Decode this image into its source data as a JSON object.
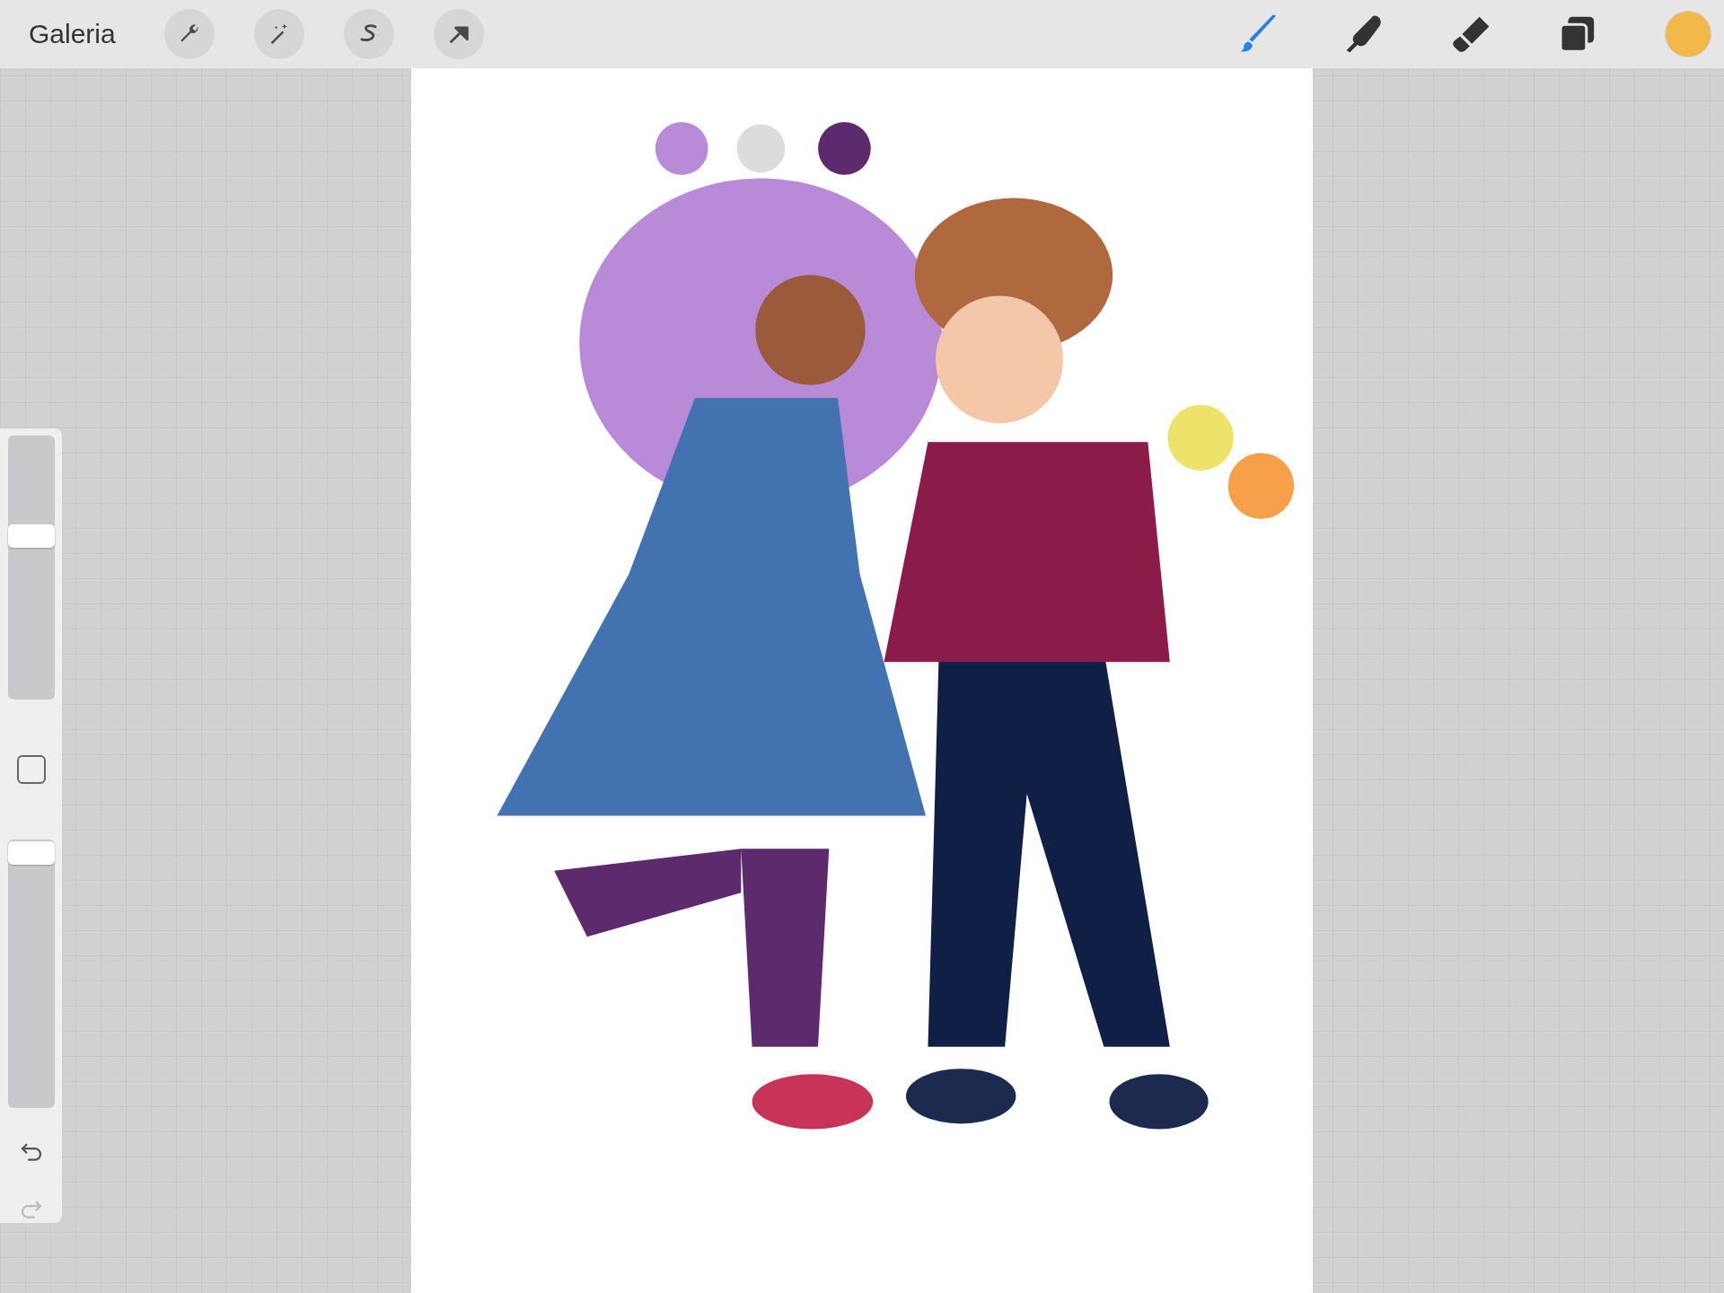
{
  "toolbar": {
    "gallery_label": "Galeria",
    "left_tools": [
      {
        "kind": "wrench"
      },
      {
        "kind": "wand"
      },
      {
        "kind": "selection"
      },
      {
        "kind": "transform"
      }
    ],
    "right_tools": [
      {
        "kind": "brush",
        "selected": true
      },
      {
        "kind": "smudge",
        "selected": false
      },
      {
        "kind": "eraser",
        "selected": false
      },
      {
        "kind": "layers",
        "selected": false
      }
    ]
  },
  "sidebar": {
    "size_slider": {
      "level": 0.62
    },
    "opacity_slider": {
      "level": 0.95
    }
  }
}
